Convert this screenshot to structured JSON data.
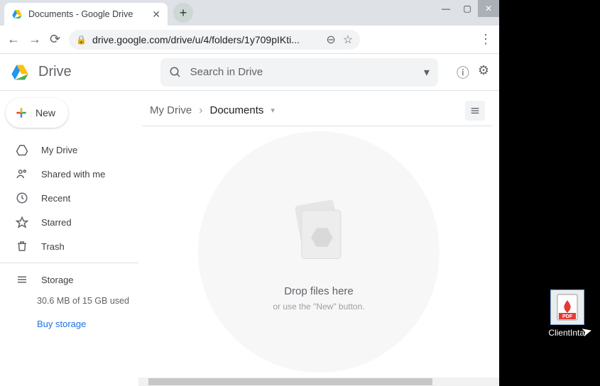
{
  "tab": {
    "title": "Documents - Google Drive"
  },
  "url": "drive.google.com/drive/u/4/folders/1y709pIKti...",
  "app_name": "Drive",
  "search": {
    "placeholder": "Search in Drive"
  },
  "new_button": "New",
  "sidebar": {
    "items": [
      {
        "icon": "drive-icon",
        "label": "My Drive"
      },
      {
        "icon": "shared-icon",
        "label": "Shared with me"
      },
      {
        "icon": "recent-icon",
        "label": "Recent"
      },
      {
        "icon": "star-icon",
        "label": "Starred"
      },
      {
        "icon": "trash-icon",
        "label": "Trash"
      }
    ],
    "storage_label": "Storage",
    "storage_used": "30.6 MB of 15 GB used",
    "buy_storage": "Buy storage"
  },
  "breadcrumb": {
    "root": "My Drive",
    "current": "Documents"
  },
  "dropzone": {
    "title": "Drop files here",
    "subtitle": "or use the \"New\" button."
  },
  "desktop_file": {
    "name": "ClientIntal",
    "type": "PDF"
  }
}
